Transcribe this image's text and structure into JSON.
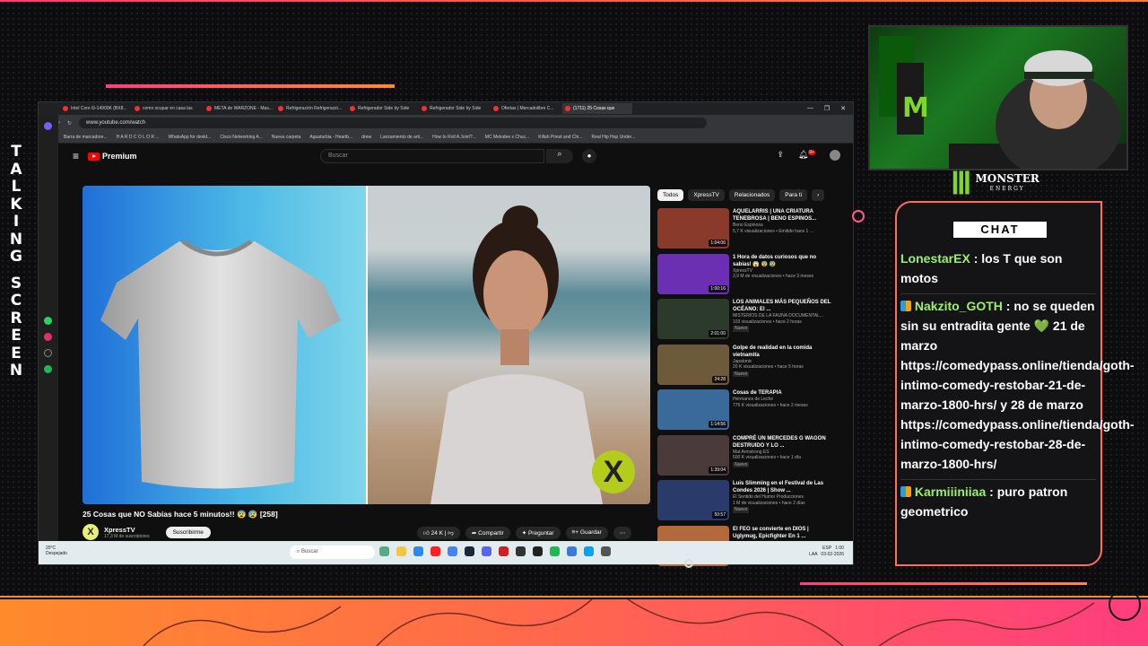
{
  "overlay": {
    "side_text": [
      "T",
      "A",
      "L",
      "K",
      "I",
      "N",
      "G",
      "S",
      "C",
      "R",
      "E",
      "E",
      "N"
    ],
    "accent_pink": "#ff3d7f",
    "accent_orange": "#ff8a2c"
  },
  "browser": {
    "tabs": [
      "Intel Core i9-14900K (BX8...",
      "como ocupar en casa las",
      "META de WARZONE - Mas...",
      "Refrigeración Refrigeració...",
      "Refrigerador Side by Side",
      "Refrigerador Side by Side",
      "Ofertas | Mercadolibre C...",
      "(1711) 25 Cosas que"
    ],
    "url": "www.youtube.com/watch",
    "bookmarks": [
      "Barra de marcadore...",
      "H A R D C O L O R ...",
      "WhatsApp for deskt...",
      "Cisco Networking A...",
      "Nueva carpeta",
      "Aguaturbia - Heartb...",
      "drew",
      "Lanzamiento de arti...",
      "How to Roll A Joint?...",
      "MC Melodee x Chuc...",
      "Killah Priest and Chi...",
      "Real Hip Hop Under..."
    ]
  },
  "youtube": {
    "logo": "Premium",
    "search_placeholder": "Buscar",
    "notif_count": "9+",
    "video_title": "25 Cosas que NO Sabías hace 5 minutos!! 😨 😰 [258]",
    "channel": "XpressTV",
    "subscribers": "17,3 M de suscriptores",
    "subscribe": "Suscribirme",
    "likes": "24 K",
    "share": "Compartir",
    "ask": "Preguntar",
    "save": "Guardar",
    "chips": [
      "Todos",
      "XpressTV",
      "Relacionados",
      "Para ti"
    ],
    "related": [
      {
        "title": "AQUELARRIS | UNA CRIATURA TENEBROSA | BENO ESPINOS...",
        "channel": "Beno Espinosa",
        "meta": "5,7 K visualizaciones • Emitido hace 1 ...",
        "duration": "1:04:06",
        "badge": "",
        "color": "#8a3a2a"
      },
      {
        "title": "1 Hora de datos curiosos que no sabías! 😱 😨 😰",
        "channel": "XpressTV",
        "meta": "3,9 M de visualizaciones • hace 3 meses",
        "duration": "1:00:16",
        "badge": "",
        "color": "#6a2fb3"
      },
      {
        "title": "LOS ANIMALES MÁS PEQUEÑOS DEL OCÉANO: El ...",
        "channel": "MISTERIOS DE LA FAUNA DOCUMENTAL...",
        "meta": "103 visualizaciones • hace 2 horas",
        "duration": "2:01:00",
        "badge": "Nuevo",
        "color": "#2b3a2a"
      },
      {
        "title": "Golpe de realidad en la comida vietnamita",
        "channel": "Japatonic",
        "meta": "20 K visualizaciones • hace 5 horas",
        "duration": "24:28",
        "badge": "Nuevo",
        "color": "#6d5a3a"
      },
      {
        "title": "Cosas de TERAPIA",
        "channel": "Hermanos de Leche",
        "meta": "775 K visualizaciones • hace 2 meses",
        "duration": "1:14:56",
        "badge": "",
        "color": "#3a6a9a"
      },
      {
        "title": "COMPRÉ UN MERCEDES G WAGON DESTRUIDO Y LO ...",
        "channel": "Mat Armstrong ES",
        "meta": "500 K visualizaciones • hace 1 día",
        "duration": "1:39:04",
        "badge": "Nuevo",
        "color": "#4a3a3a"
      },
      {
        "title": "Luis Slimming en el Festival de Las Condes 2026 | Show ...",
        "channel": "El Sentido del Humor Producciones",
        "meta": "1 M de visualizaciones • hace 2 días",
        "duration": "50:57",
        "badge": "Nuevo",
        "color": "#2a3a6a"
      },
      {
        "title": "El FEO se convierte en DIOS | Uglymug, Epicfighter En 1 ...",
        "channel": "",
        "meta": "",
        "duration": "",
        "badge": "",
        "color": "#b36a3a"
      }
    ]
  },
  "taskbar": {
    "weather_temp": "20°C",
    "weather_text": "Despejado",
    "search": "Buscar",
    "lang": "ESP",
    "lang2": "LAA",
    "time": "1:00",
    "date": "03-02-2026"
  },
  "sponsor": {
    "name": "MONSTER",
    "sub": "ENERGY"
  },
  "chat": {
    "header": "CHAT",
    "messages": [
      {
        "user": "LonestarEX",
        "text": " : los T que son motos",
        "badge": false
      },
      {
        "user": "Nakzito_GOTH",
        "text": " : no se queden sin su entradita gente 💚 21 de marzo https://comedypass.online/tienda/goth-intimo-comedy-restobar-21-de-marzo-1800-hrs/ y 28 de marzo https://comedypass.online/tienda/goth-intimo-comedy-restobar-28-de-marzo-1800-hrs/",
        "badge": true
      },
      {
        "user": "Karmiiiniiaa",
        "text": " : puro patron geometrico",
        "badge": true
      }
    ]
  }
}
